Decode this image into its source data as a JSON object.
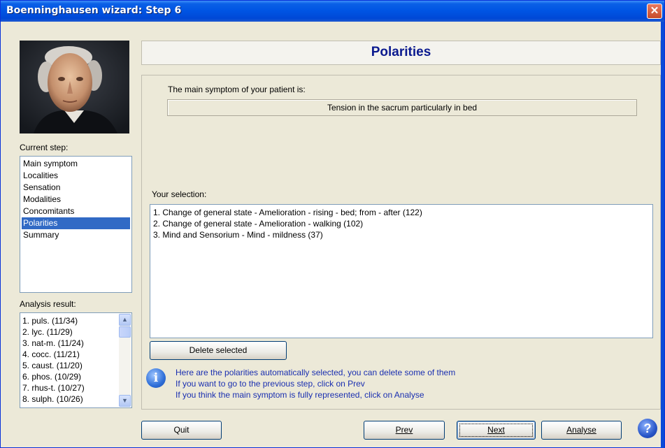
{
  "window": {
    "title": "Boenninghausen wizard: Step 6",
    "close_glyph": "✕"
  },
  "page": {
    "heading": "Polarities"
  },
  "current_step": {
    "label": "Current step:",
    "items": [
      "Main symptom",
      "Localities",
      "Sensation",
      "Modalities",
      "Concomitants",
      "Polarities",
      "Summary"
    ],
    "selected": "Polarities"
  },
  "analysis": {
    "label": "Analysis result:",
    "items": [
      "1. puls. (11/34)",
      "2. lyc. (11/29)",
      "3. nat-m. (11/24)",
      "4. cocc. (11/21)",
      "5. caust. (11/20)",
      "6. phos. (10/29)",
      "7. rhus-t. (10/27)",
      "8. sulph. (10/26)"
    ]
  },
  "main_symptom": {
    "label": "The main symptom of your patient is:",
    "value": "Tension in the sacrum particularly in bed"
  },
  "selection": {
    "label": "Your selection:",
    "items": [
      "1. Change of general state - Amelioration - rising - bed; from - after (122)",
      "2. Change of general state - Amelioration - walking (102)",
      "3. Mind and Sensorium - Mind - mildness (37)"
    ]
  },
  "buttons": {
    "delete_selected": "Delete selected",
    "quit": "Quit",
    "prev": "Prev",
    "next": "Next",
    "analyse": "Analyse"
  },
  "info": {
    "icon": "i",
    "lines": [
      "Here are the polarities automatically selected, you can delete some of them",
      "If you want to go to the previous step, click on Prev",
      "If you think the main symptom is fully represented, click on Analyse"
    ]
  },
  "help": {
    "icon": "?"
  },
  "colors": {
    "title_bar": "#0054e3",
    "heading_text": "#0b1a8f",
    "selection_highlight": "#316ac5",
    "info_text": "#1a2fb0"
  }
}
